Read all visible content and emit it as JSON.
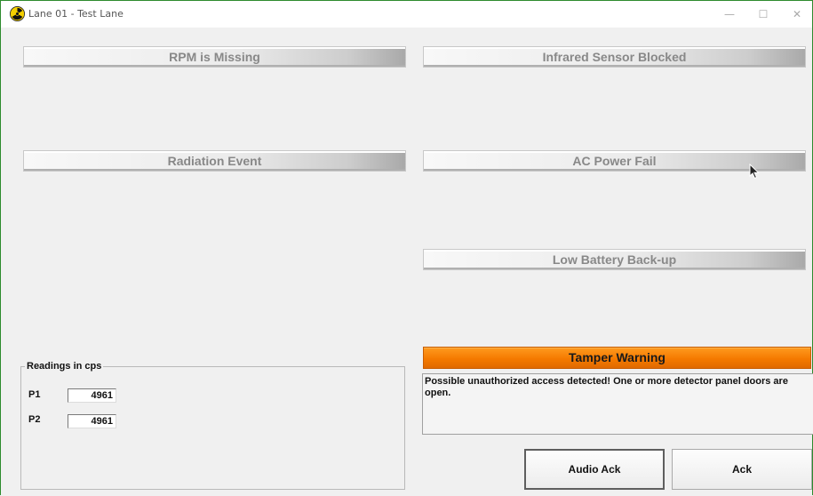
{
  "window": {
    "title": "Lane 01 - Test Lane"
  },
  "title_controls": {
    "minimize": "—",
    "maximize": "☐",
    "close": "✕"
  },
  "indicators": {
    "rpm_missing": "RPM is Missing",
    "infrared_blocked": "Infrared Sensor Blocked",
    "radiation_event": "Radiation Event",
    "ac_power_fail": "AC Power Fail",
    "low_battery": "Low Battery Back-up",
    "tamper_warning": "Tamper Warning"
  },
  "alert_message": "Possible unauthorized access detected!  One or more detector panel doors are open.",
  "readings": {
    "legend": "Readings in cps",
    "p1": {
      "label": "P1",
      "value": "4961"
    },
    "p2": {
      "label": "P2",
      "value": "4961"
    }
  },
  "buttons": {
    "audio_ack": "Audio Ack",
    "ack": "Ack"
  },
  "colors": {
    "tamper_active": "#f57a00",
    "window_border": "#2e8b2e",
    "inactive_text": "#888888"
  },
  "icons": {
    "app": "radiation-trefoil-icon",
    "pointer": "mouse-cursor-icon"
  }
}
